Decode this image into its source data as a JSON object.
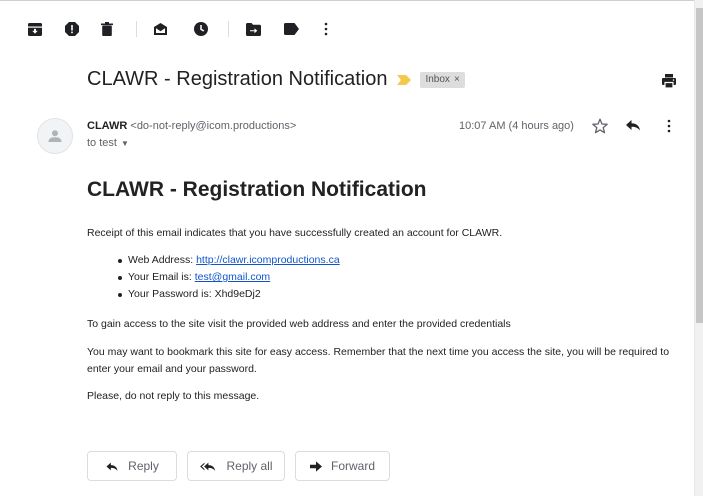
{
  "toolbar": {
    "icons": [
      "archive-icon",
      "report-spam-icon",
      "delete-icon",
      "mark-unread-icon",
      "snooze-icon",
      "move-to-icon",
      "label-icon",
      "more-vert-icon"
    ]
  },
  "email": {
    "subject": "CLAWR - Registration Notification",
    "label": "Inbox",
    "label_close": "×",
    "sender_name": "CLAWR",
    "sender_email": "<do-not-reply@icom.productions>",
    "to_text": "to test",
    "to_caret": "▼",
    "timestamp": "10:07 AM (4 hours ago)",
    "importance_color": "#f2c94c"
  },
  "body": {
    "title": "CLAWR - Registration Notification",
    "intro": "Receipt of this email indicates that you have successfully created an account for CLAWR.",
    "web_address_label": "Web Address: ",
    "web_address_link": "http://clawr.icomproductions.ca",
    "email_label": "Your Email is: ",
    "email_link": "test@gmail.com",
    "password_line": "Your Password is: Xhd9eDj2",
    "access_text": "To gain access to the site visit the provided web address and enter the provided credentials",
    "bookmark_text": "You may want to bookmark this site for easy access. Remember that the next time you access the site, you will be required to enter your email and your password.",
    "noreply_text": "Please, do not reply to this message."
  },
  "actions": {
    "reply": "Reply",
    "reply_all": "Reply all",
    "forward": "Forward"
  }
}
